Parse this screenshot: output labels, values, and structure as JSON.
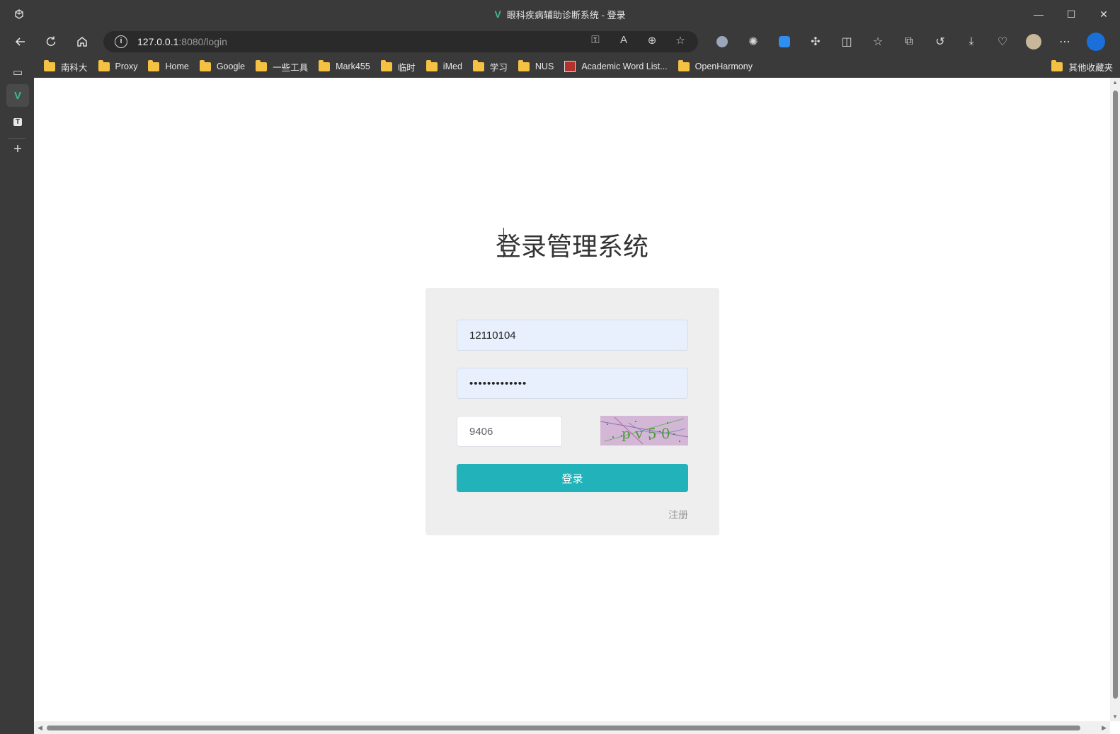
{
  "window": {
    "title": "眼科疾病辅助诊断系统 - 登录",
    "controls": {
      "minimize": "—",
      "maximize": "☐",
      "close": "✕"
    }
  },
  "addressbar": {
    "url_host": "127.0.0.1",
    "url_rest": ":8080/login"
  },
  "bookmarks": [
    {
      "label": "南科大",
      "icon": "folder-icon"
    },
    {
      "label": "Proxy",
      "icon": "folder-icon"
    },
    {
      "label": "Home",
      "icon": "folder-icon"
    },
    {
      "label": "Google",
      "icon": "folder-icon"
    },
    {
      "label": "一些工具",
      "icon": "folder-icon"
    },
    {
      "label": "Mark455",
      "icon": "folder-icon"
    },
    {
      "label": "临时",
      "icon": "folder-icon"
    },
    {
      "label": "iMed",
      "icon": "folder-icon"
    },
    {
      "label": "学习",
      "icon": "folder-icon"
    },
    {
      "label": "NUS",
      "icon": "folder-icon"
    },
    {
      "label": "Academic Word List...",
      "icon": "site-favicon"
    },
    {
      "label": "OpenHarmony",
      "icon": "folder-icon"
    }
  ],
  "bookmarks_other": "其他收藏夹",
  "login": {
    "heading": "登录管理系统",
    "username_value": "12110104",
    "password_value": "•••••••••••••",
    "captcha_input_value": "9406",
    "captcha_image_text": "p v 5 0",
    "login_button": "登录",
    "register_link": "注册"
  },
  "colors": {
    "login_button": "#21b3b9",
    "card_background": "#eeeeee",
    "autofill_background": "#e8f0fe"
  }
}
